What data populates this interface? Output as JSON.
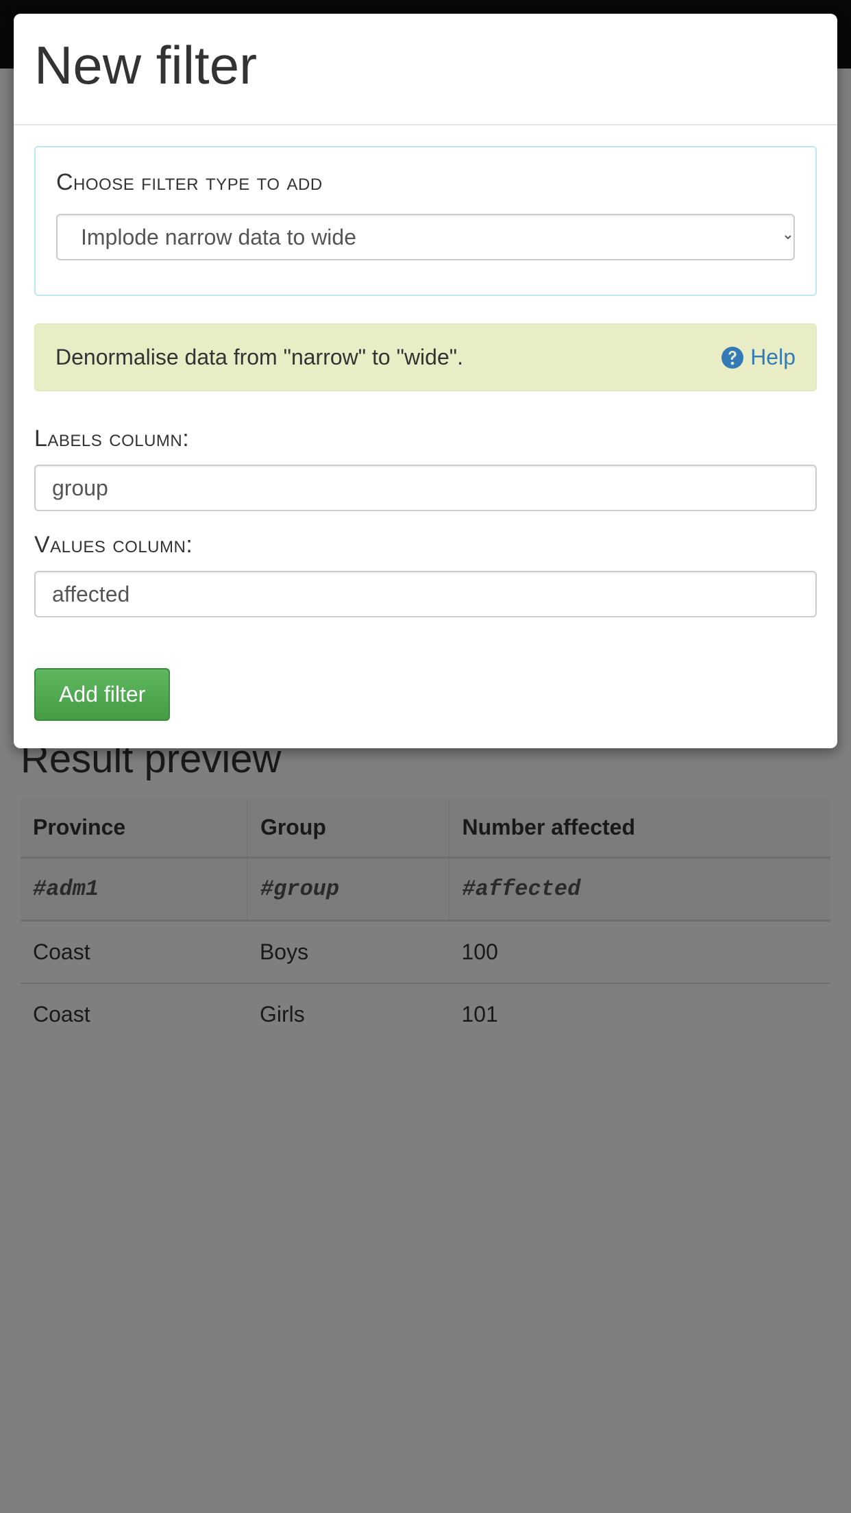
{
  "modal": {
    "title": "New filter",
    "choose_label": "Choose filter type to add",
    "filter_type_selected": "Implode narrow data to wide",
    "info_text": "Denormalise data from \"narrow\" to \"wide\".",
    "help_label": "Help",
    "labels_column_label": "Labels column:",
    "labels_column_value": "group",
    "values_column_label": "Values column:",
    "values_column_value": "affected",
    "add_button_label": "Add filter"
  },
  "preview": {
    "heading": "Result preview",
    "columns": [
      "Province",
      "Group",
      "Number affected"
    ],
    "hashtags": [
      "#adm1",
      "#group",
      "#affected"
    ],
    "rows": [
      [
        "Coast",
        "Boys",
        "100"
      ],
      [
        "Coast",
        "Girls",
        "101"
      ]
    ]
  }
}
